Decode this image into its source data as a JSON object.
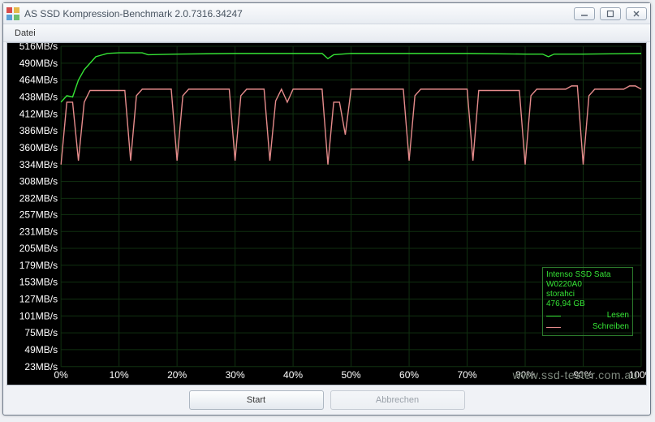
{
  "window": {
    "title": "AS SSD Kompression-Benchmark 2.0.7316.34247"
  },
  "menu": {
    "datei": "Datei"
  },
  "buttons": {
    "start": "Start",
    "abbrechen": "Abbrechen"
  },
  "legend": {
    "device": "Intenso SSD Sata",
    "firmware": "W0220A0",
    "driver": "storahci",
    "size": "476,94 GB",
    "series_read": "Lesen",
    "series_write": "Schreiben"
  },
  "watermark": "www.ssd-tester.com.au",
  "chart_data": {
    "type": "line",
    "xlabel": "",
    "ylabel": "",
    "xlim": [
      0,
      100
    ],
    "ylim": [
      23,
      516
    ],
    "x_ticks": [
      0,
      10,
      20,
      30,
      40,
      50,
      60,
      70,
      80,
      90,
      100
    ],
    "y_ticks": [
      23,
      49,
      75,
      101,
      127,
      153,
      179,
      205,
      231,
      257,
      282,
      308,
      334,
      360,
      386,
      412,
      438,
      464,
      490,
      516
    ],
    "y_unit": "MB/s",
    "series": [
      {
        "name": "Lesen",
        "color": "#35e335",
        "x": [
          0,
          1,
          2,
          3,
          4,
          5,
          6,
          8,
          10,
          14,
          15,
          20,
          30,
          40,
          45,
          46,
          47,
          50,
          55,
          60,
          70,
          80,
          83,
          84,
          85,
          90,
          100
        ],
        "values": [
          430,
          440,
          438,
          464,
          480,
          490,
          500,
          505,
          506,
          506,
          503,
          504,
          505,
          505,
          505,
          497,
          503,
          505,
          505,
          505,
          505,
          504,
          504,
          500,
          504,
          504,
          505
        ]
      },
      {
        "name": "Schreiben",
        "color": "#e58b8b",
        "x": [
          0,
          1,
          2,
          3,
          4,
          5,
          6,
          7,
          8,
          9,
          10,
          11,
          12,
          13,
          14,
          15,
          16,
          17,
          18,
          19,
          20,
          21,
          22,
          23,
          24,
          25,
          26,
          27,
          28,
          29,
          30,
          31,
          32,
          33,
          34,
          35,
          36,
          37,
          38,
          39,
          40,
          41,
          42,
          43,
          44,
          45,
          46,
          47,
          48,
          49,
          50,
          51,
          52,
          53,
          54,
          55,
          56,
          57,
          58,
          59,
          60,
          61,
          62,
          63,
          64,
          65,
          66,
          67,
          68,
          69,
          70,
          71,
          72,
          73,
          74,
          75,
          76,
          77,
          78,
          79,
          80,
          81,
          82,
          83,
          84,
          85,
          86,
          87,
          88,
          89,
          90,
          91,
          92,
          93,
          94,
          95,
          96,
          97,
          98,
          99,
          100
        ],
        "values": [
          334,
          430,
          430,
          340,
          430,
          448,
          448,
          448,
          448,
          448,
          448,
          448,
          340,
          440,
          450,
          450,
          450,
          450,
          450,
          450,
          340,
          440,
          450,
          450,
          450,
          450,
          450,
          450,
          450,
          450,
          340,
          440,
          450,
          450,
          450,
          450,
          340,
          432,
          450,
          430,
          450,
          450,
          450,
          450,
          450,
          450,
          334,
          430,
          430,
          380,
          450,
          450,
          450,
          450,
          450,
          450,
          450,
          450,
          450,
          450,
          340,
          440,
          450,
          450,
          450,
          450,
          450,
          450,
          450,
          450,
          450,
          340,
          448,
          448,
          448,
          448,
          448,
          448,
          448,
          448,
          334,
          440,
          450,
          450,
          450,
          450,
          450,
          450,
          455,
          455,
          334,
          440,
          450,
          450,
          450,
          450,
          450,
          450,
          455,
          455,
          450
        ]
      }
    ]
  }
}
